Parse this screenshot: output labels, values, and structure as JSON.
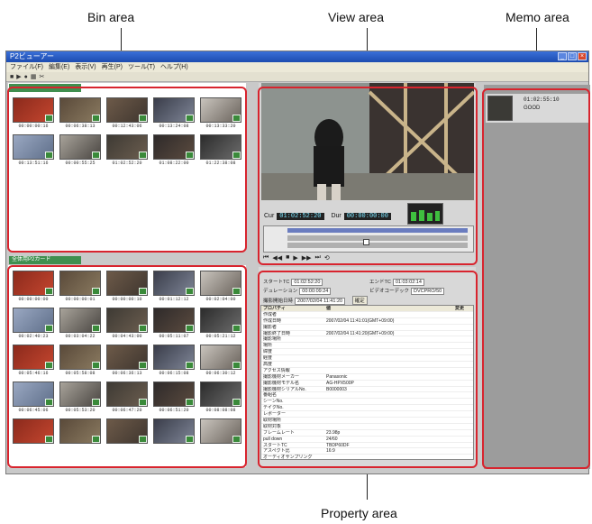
{
  "callouts": {
    "bin": "Bin area",
    "view": "View area",
    "memo": "Memo area",
    "property": "Property area"
  },
  "window": {
    "title": "P2ビューアー",
    "menu": [
      "ファイル(F)",
      "編集(E)",
      "表示(V)",
      "再生(P)",
      "ツール(T)",
      "ヘルプ(H)"
    ]
  },
  "bin_upper": {
    "timecodes": [
      "00:00:00:16",
      "00:06:38:13",
      "00:12:43:06",
      "00:13:24:08",
      "00:13:33:20",
      "00:13:51:16",
      "00:00:55:25",
      "01:02:52:20",
      "01:08:22:00",
      "01:22:38:08"
    ]
  },
  "bin_lower": {
    "header": "全体用P2カード",
    "timecodes": [
      "00:00:00:00",
      "00:00:00:01",
      "00:00:00:10",
      "00:01:12:12",
      "00:02:04:00",
      "00:02:40:23",
      "00:03:04:22",
      "00:04:43:00",
      "00:05:11:07",
      "00:05:21:12",
      "00:05:46:16",
      "00:05:58:08",
      "00:06:36:13",
      "00:06:15:08",
      "00:06:30:12",
      "00:06:45:06",
      "00:05:53:20",
      "00:06:47:20",
      "00:06:51:20",
      "00:08:08:08",
      "",
      "",
      "",
      "",
      ""
    ]
  },
  "view": {
    "cur_label": "Cur",
    "cur_tc": "01:02:52:20",
    "dur_label": "Dur",
    "dur_tc": "00:00:00:00"
  },
  "property": {
    "top_fields": [
      {
        "label": "スタートTC",
        "value": "01:02:52:20"
      },
      {
        "label": "エンドTC",
        "value": "01:03:02:14"
      },
      {
        "label": "デュレーション",
        "value": "00:00:09:24"
      },
      {
        "label": "ビデオコーデック",
        "value": "DVCPRO/50"
      },
      {
        "label": "撮影開始日時",
        "value": "2007/02/04 11:41:20"
      }
    ],
    "button": "確定",
    "col_prop": "プロパティ",
    "col_val": "値",
    "col_change": "変更",
    "rows": [
      {
        "k": "作成者",
        "v": ""
      },
      {
        "k": "作成日時",
        "v": "2007/02/04 11:41:01(GMT+09:00)"
      },
      {
        "k": "撮影者",
        "v": ""
      },
      {
        "k": "撮影終了日時",
        "v": "2007/02/04 11:41:20(GMT+09:00)"
      },
      {
        "k": "撮影場所",
        "v": ""
      },
      {
        "k": "場所",
        "v": ""
      },
      {
        "k": "緯度",
        "v": ""
      },
      {
        "k": "経度",
        "v": ""
      },
      {
        "k": "高度",
        "v": ""
      },
      {
        "k": "アクセス情報",
        "v": ""
      },
      {
        "k": "撮影機材メーカー",
        "v": "Panasonic"
      },
      {
        "k": "撮影機材モデル名",
        "v": "AG-HPX500P"
      },
      {
        "k": "撮影機材シリアルNo.",
        "v": "B0000003"
      },
      {
        "k": "番組名",
        "v": ""
      },
      {
        "k": "シーンNo.",
        "v": ""
      },
      {
        "k": "テイクNo.",
        "v": ""
      },
      {
        "k": "レポーター",
        "v": ""
      },
      {
        "k": "取材場所",
        "v": ""
      },
      {
        "k": "取材対象",
        "v": ""
      },
      {
        "k": "フレームレート",
        "v": "23.98p"
      },
      {
        "k": "pull down",
        "v": "24/60"
      },
      {
        "k": "スタートTC",
        "v": "TBDP60DF"
      },
      {
        "k": "アスペクト比",
        "v": "16:9"
      },
      {
        "k": "オーディオサンプリング",
        "v": ""
      }
    ]
  },
  "memo": {
    "tc": "01:02:55:10",
    "text": "GOOD"
  }
}
